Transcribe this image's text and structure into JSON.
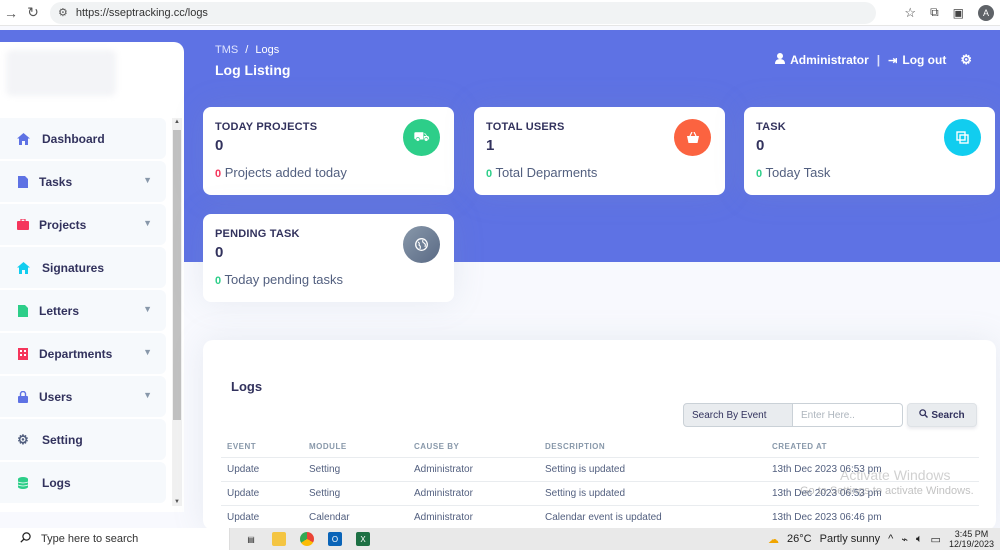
{
  "browser": {
    "url": "https://sseptracking.cc/logs",
    "profile_initial": "A"
  },
  "header": {
    "breadcrumb_root": "TMS",
    "breadcrumb_sep": "/",
    "breadcrumb_current": "Logs",
    "title": "Log Listing",
    "user_label": "Administrator",
    "divider": "|",
    "logout_label": "Log out"
  },
  "sidebar": {
    "items": [
      {
        "label": "Dashboard",
        "icon": "home-icon"
      },
      {
        "label": "Tasks",
        "icon": "file-icon"
      },
      {
        "label": "Projects",
        "icon": "briefcase-icon"
      },
      {
        "label": "Signatures",
        "icon": "home-icon"
      },
      {
        "label": "Letters",
        "icon": "file-icon"
      },
      {
        "label": "Departments",
        "icon": "building-icon"
      },
      {
        "label": "Users",
        "icon": "lock-icon"
      },
      {
        "label": "Setting",
        "icon": "gear-icon"
      },
      {
        "label": "Logs",
        "icon": "database-icon"
      }
    ]
  },
  "cards": {
    "projects": {
      "title": "TODAY PROJECTS",
      "value": "0",
      "sub_count": "0",
      "sub_text": "Projects added today",
      "color": "#2dce89"
    },
    "users": {
      "title": "TOTAL USERS",
      "value": "1",
      "sub_count": "0",
      "sub_text": "Total Deparments",
      "color": "#fb6340"
    },
    "task": {
      "title": "TASK",
      "value": "0",
      "sub_count": "0",
      "sub_text": "Today Task",
      "color": "#11cdef"
    },
    "pending": {
      "title": "PENDING TASK",
      "value": "0",
      "sub_count": "0",
      "sub_text": "Today pending tasks",
      "color": "#8898aa"
    }
  },
  "logs": {
    "title": "Logs",
    "search_label": "Search By Event",
    "search_placeholder": "Enter Here..",
    "search_button": "Search",
    "columns": [
      "EVENT",
      "MODULE",
      "CAUSE BY",
      "DESCRIPTION",
      "CREATED AT"
    ],
    "rows": [
      [
        "Update",
        "Setting",
        "Administrator",
        "Setting is updated",
        "13th Dec 2023 06:53 pm"
      ],
      [
        "Update",
        "Setting",
        "Administrator",
        "Setting is updated",
        "13th Dec 2023 06:53 pm"
      ],
      [
        "Update",
        "Calendar",
        "Administrator",
        "Calendar event is updated",
        "13th Dec 2023 06:46 pm"
      ]
    ]
  },
  "watermark": {
    "line1": "Activate Windows",
    "line2": "Go to Settings to activate Windows."
  },
  "taskbar": {
    "search_placeholder": "Type here to search",
    "temperature": "26°C",
    "weather": "Partly sunny",
    "time": "3:45 PM",
    "date": "12/19/2023"
  },
  "colors": {
    "primary": "#5e72e4",
    "text": "#32325d"
  }
}
